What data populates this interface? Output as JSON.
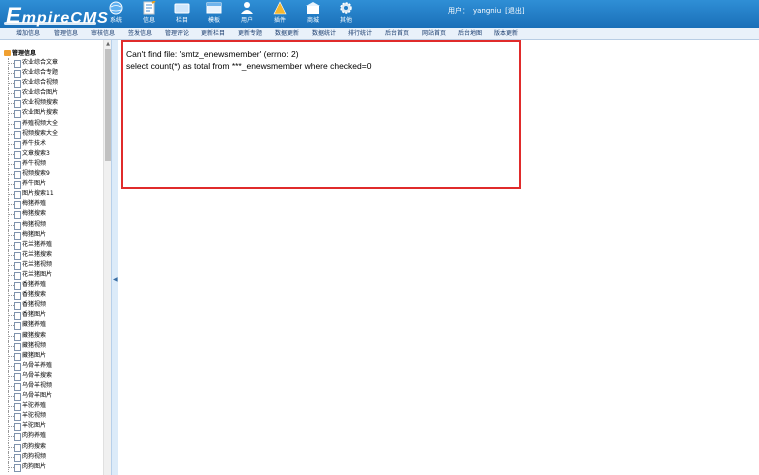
{
  "header": {
    "logo": {
      "big": "E",
      "rest": "mpireCMS"
    },
    "nav": [
      {
        "label": "系统",
        "icon": "globe-icon"
      },
      {
        "label": "信息",
        "icon": "notepad-icon"
      },
      {
        "label": "栏目",
        "icon": "folder-icon"
      },
      {
        "label": "模板",
        "icon": "window-icon"
      },
      {
        "label": "用户",
        "icon": "user-icon"
      },
      {
        "label": "插件",
        "icon": "puzzle-icon"
      },
      {
        "label": "商城",
        "icon": "shop-icon"
      },
      {
        "label": "其他",
        "icon": "gear-icon"
      }
    ],
    "user_label": "用户：",
    "username": "yangniu",
    "logout": "[退出]"
  },
  "subnav": [
    "增加信息",
    "管理信息",
    "审核信息",
    "签发信息",
    "管理评论",
    "更新栏目",
    "更新专题",
    "数据更新",
    "数据统计",
    "排行统计",
    "后台首页",
    "网站首页",
    "后台地图",
    "版本更新"
  ],
  "sidebar": {
    "root": "管理信息",
    "items": [
      "农业综合文章",
      "农业综合专题",
      "农业综合视频",
      "农业综合图片",
      "农业视频搜索",
      "农业图片搜索",
      "养殖视频大全",
      "视频搜索大全",
      "养牛技术",
      "文章搜索3",
      "养牛视频",
      "视频搜索9",
      "养牛图片",
      "图片搜索11",
      "梅猪养殖",
      "梅猪搜索",
      "梅猪视频",
      "梅猪图片",
      "花兰猪养殖",
      "花兰猪搜索",
      "花兰猪视频",
      "花兰猪图片",
      "香猪养殖",
      "香猪搜索",
      "香猪视频",
      "香猪图片",
      "藏猪养殖",
      "藏猪搜索",
      "藏猪视频",
      "藏猪图片",
      "乌骨羊养殖",
      "乌骨羊搜索",
      "乌骨羊视频",
      "乌骨羊图片",
      "羊驼养殖",
      "羊驼视频",
      "羊驼图片",
      "肉狗养殖",
      "肉狗搜索",
      "肉狗视频",
      "肉狗图片"
    ]
  },
  "main": {
    "error_line1": "Can't find file: 'smtz_enewsmember' (errno: 2)",
    "error_line2": "select count(*) as total from ***_enewsmember where checked=0"
  },
  "colors": {
    "header": "#1f7cc6",
    "error_border": "#e02b2b",
    "subnav_bg": "#e9f1fa"
  }
}
